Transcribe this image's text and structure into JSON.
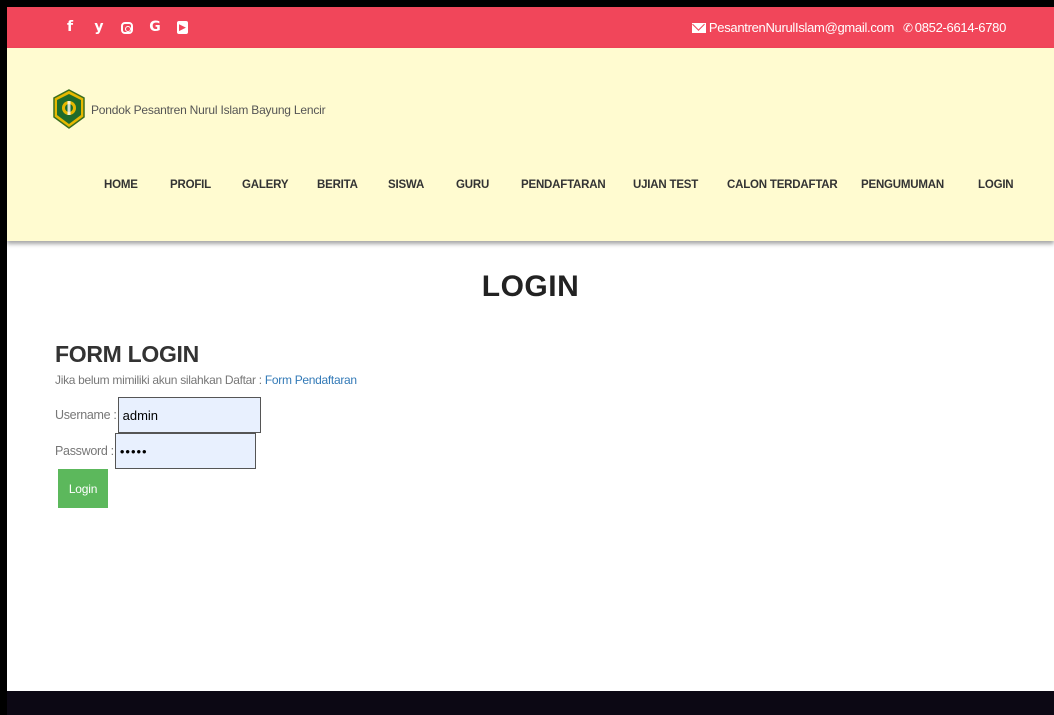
{
  "topbar": {
    "social_icons": [
      {
        "name": "facebook-icon",
        "glyph": "f"
      },
      {
        "name": "twitter-icon",
        "glyph": "🐦"
      },
      {
        "name": "instagram-icon",
        "glyph": ""
      },
      {
        "name": "google-icon",
        "glyph": "G"
      },
      {
        "name": "youtube-icon",
        "glyph": "You"
      }
    ],
    "email": "PesantrenNurulIslam@gmail.com",
    "phone": "0852-6614-6780",
    "bg_color": "#f1465a"
  },
  "header": {
    "site_name": "Pondok Pesantren Nurul Islam Bayung Lencir",
    "bg_color": "#fffbd0"
  },
  "nav": {
    "items": [
      "HOME",
      "PROFIL",
      "GALERY",
      "BERITA",
      "SISWA",
      "GURU",
      "PENDAFTARAN",
      "UJIAN TEST",
      "CALON TERDAFTAR",
      "PENGUMUMAN",
      "LOGIN"
    ]
  },
  "main": {
    "page_title": "LOGIN",
    "form_title": "FORM LOGIN",
    "hint_text": "Jika belum mimiliki akun silahkan Daftar : ",
    "hint_link": "Form Pendaftaran",
    "username_label": "Username : ",
    "username_value": "admin",
    "password_label": "Password : ",
    "password_value": "•••••",
    "login_button": "Login",
    "button_color": "#5cb85c"
  }
}
